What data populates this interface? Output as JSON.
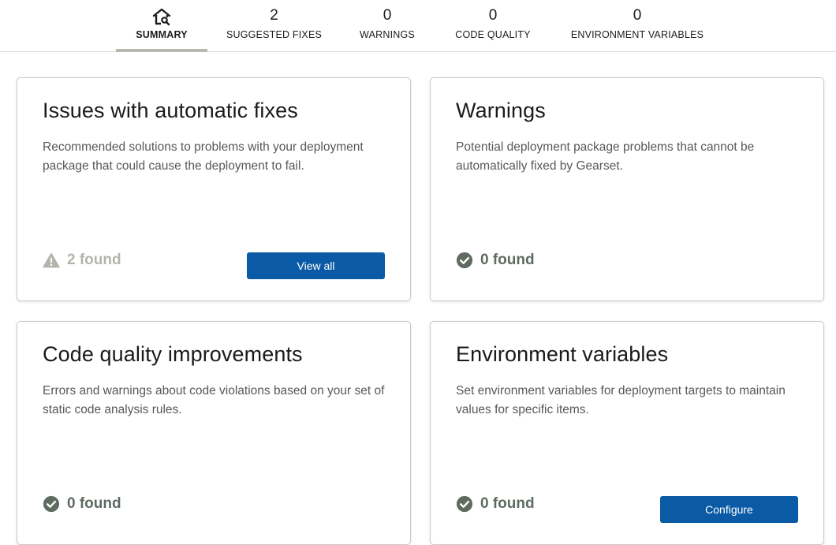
{
  "tabs": {
    "summary": {
      "label": "SUMMARY",
      "icon": "home-search-icon"
    },
    "suggested_fixes": {
      "count": "2",
      "label": "SUGGESTED FIXES"
    },
    "warnings": {
      "count": "0",
      "label": "WARNINGS"
    },
    "code_quality": {
      "count": "0",
      "label": "CODE QUALITY"
    },
    "environment_variables": {
      "count": "0",
      "label": "ENVIRONMENT VARIABLES"
    }
  },
  "cards": {
    "automatic_fixes": {
      "title": "Issues with automatic fixes",
      "description": "Recommended solutions to problems with your deployment package that could cause the deployment to fail.",
      "status": "2 found",
      "status_icon": "warning-triangle-icon",
      "button": "View all"
    },
    "warnings": {
      "title": "Warnings",
      "description": "Potential deployment package problems that cannot be automatically fixed by Gearset.",
      "status": "0 found",
      "status_icon": "check-circle-icon"
    },
    "code_quality": {
      "title": "Code quality improvements",
      "description": "Errors and warnings about code violations based on your set of static code analysis rules.",
      "status": "0 found",
      "status_icon": "check-circle-icon"
    },
    "environment_variables": {
      "title": "Environment variables",
      "description": "Set environment variables for deployment targets to maintain values for specific items.",
      "status": "0 found",
      "status_icon": "check-circle-icon",
      "button": "Configure"
    }
  },
  "colors": {
    "primary_button": "#0b5aa5",
    "active_tab_underline": "#b7b9ae",
    "success_icon": "#5f6b61",
    "warning_muted": "#b3b5ac"
  }
}
